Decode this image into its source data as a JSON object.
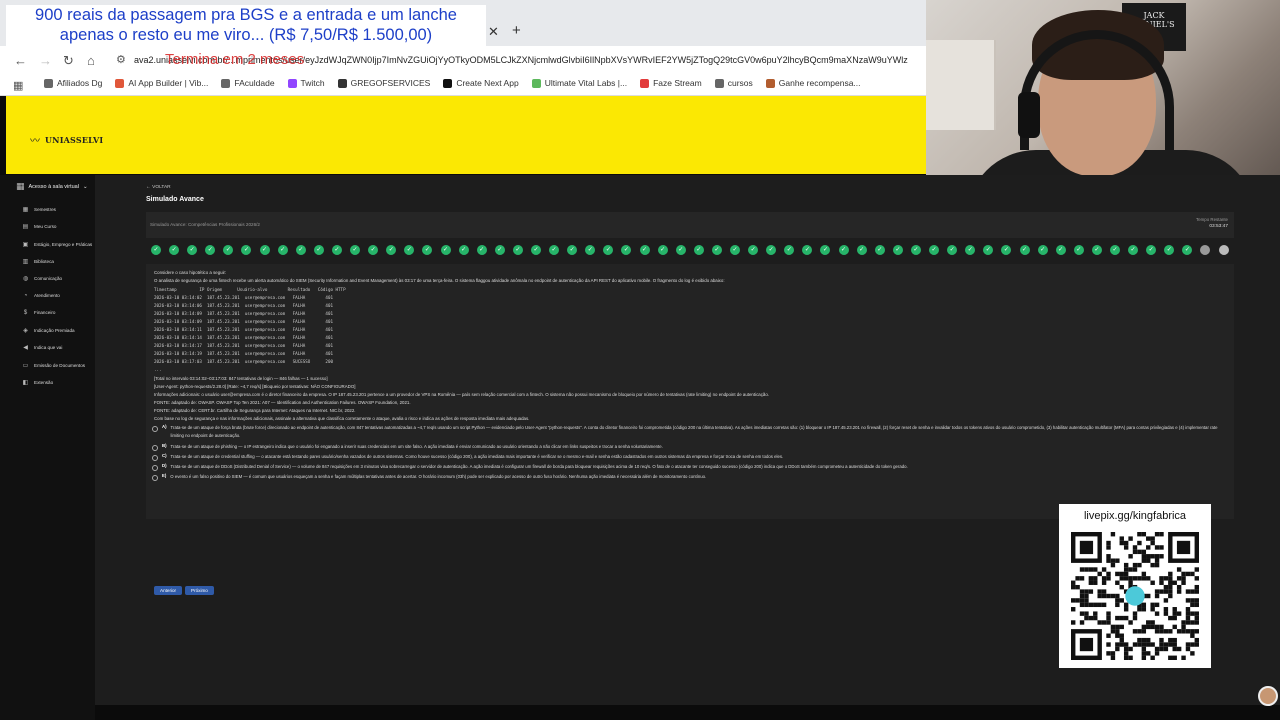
{
  "stream": {
    "banner": "900 reais da passagem pra BGS e a entrada e um lanche apenas o resto eu me viro... (R$ 7,50/R$ 1.500,00)",
    "countdown": "Termina em 2 meses",
    "qr_url": "livepix.gg/kingfabrica",
    "poster": "JACK DANIEL'S"
  },
  "browser": {
    "url": "ava2.uniasselvi.com.br/...mprimentos/user/eyJzdWJqZWN0Ijp7ImNvZGUiOjYyOTkyODM5LCJkZXNjcmlwdGlvbiI6IlNpbXVsYWRvIEF2YW5jZTogQ29tcGV0w6puY2lhcyBQcm9maXNzaW9uYWlz",
    "bookmarks": [
      {
        "label": "Afiliados Dg",
        "color": "#666666"
      },
      {
        "label": "AI App Builder | Vib...",
        "color": "#e0573a"
      },
      {
        "label": "FAculdade",
        "color": "#666666"
      },
      {
        "label": "Twitch",
        "color": "#9146ff"
      },
      {
        "label": "GREGOFSERVICES",
        "color": "#333333"
      },
      {
        "label": "Create Next App",
        "color": "#111111"
      },
      {
        "label": "Ultimate Vital Labs |...",
        "color": "#5cb85c"
      },
      {
        "label": "Faze Stream",
        "color": "#e23b3b"
      },
      {
        "label": "cursos",
        "color": "#666666"
      },
      {
        "label": "Ganhe recompensa...",
        "color": "#b25d2f"
      }
    ]
  },
  "brand": "UNIASSELVI",
  "sidebar": {
    "title": "Acesso à sala virtual",
    "items": [
      {
        "label": "Semestres",
        "icon": "calendar-icon",
        "glyph": "▦"
      },
      {
        "label": "Meu Curso",
        "icon": "book-icon",
        "glyph": "▤"
      },
      {
        "label": "Estágio, Emprego e Práticas",
        "icon": "briefcase-icon",
        "glyph": "▣"
      },
      {
        "label": "Biblioteca",
        "icon": "library-icon",
        "glyph": "▥"
      },
      {
        "label": "Comunicação",
        "icon": "chat-icon",
        "glyph": "◍"
      },
      {
        "label": "Atendimento",
        "icon": "headset-icon",
        "glyph": "◔"
      },
      {
        "label": "Financeiro",
        "icon": "dollar-icon",
        "glyph": "$"
      },
      {
        "label": "Indicação Premiada",
        "icon": "gift-icon",
        "glyph": "◈"
      },
      {
        "label": "Indica que vai",
        "icon": "megaphone-icon",
        "glyph": "◀"
      },
      {
        "label": "Emissão de Documentos",
        "icon": "document-icon",
        "glyph": "▭"
      },
      {
        "label": "Extensão",
        "icon": "puzzle-icon",
        "glyph": "◧"
      }
    ]
  },
  "main": {
    "back": "VOLTAR",
    "title": "Simulado Avance",
    "subtitle": "Simulado Avance: Competências Profissionais 2026/2",
    "timer_label": "Tempo Restante",
    "timer_value": "03:53:47",
    "progress": {
      "total": 60,
      "done": 58,
      "current": 59
    }
  },
  "question": {
    "intro": "Considere o caso hipotético a seguir:",
    "context": "O analista de segurança de uma fintech recebe um alerta automático do SIEM (Security Information and Event Management) às 03:17 de uma terça-feira. O sistema flaggou atividade anômala no endpoint de autenticação da API REST do aplicativo mobile. O fragmento do log é exibido abaixo:",
    "log_header": "Timestamp         IP Origem      Usuário-alvo        Resultado   Código HTTP",
    "log_rows": [
      "2026-03-10 03:14:02  187.45.23.201  user@empresa.com   FALHA        401",
      "2026-03-10 03:14:06  187.45.23.201  user@empresa.com   FALHA        401",
      "2026-03-10 03:14:09  187.45.23.201  user@empresa.com   FALHA        401",
      "2026-03-10 03:14:09  187.45.23.201  user@empresa.com   FALHA        401",
      "2026-03-10 03:14:11  187.45.23.201  user@empresa.com   FALHA        401",
      "2026-03-10 03:14:14  187.45.23.201  user@empresa.com   FALHA        401",
      "2026-03-10 03:14:17  187.45.23.201  user@empresa.com   FALHA        401",
      "2026-03-10 03:14:19  187.45.23.201  user@empresa.com   FALHA        401",
      "2026-03-10 03:17:03  187.45.23.201  user@empresa.com   SUCESSO      200"
    ],
    "log_dots": "...",
    "total_line": "[Total no intervalo 03:14:02–03:17:03: 847 tentativas de login — 846 falhas — 1 sucesso]",
    "agent_line": "[User-Agent: python-requests/2.28.0]  [Rate: ~4,7 req/s]  [Bloqueio por tentativas: NÃO CONFIGURADO]",
    "info_line": "Informações adicionais: o usuário user@empresa.com é o diretor financeiro da empresa. O IP 187.45.23.201 pertence a um provedor de VPS na Romênia — país sem relação comercial com a fintech. O sistema não possui mecanismo de bloqueio por número de tentativas (rate limiting) no endpoint de autenticação.",
    "source1": "FONTE: adaptado de: OWASP. OWASP Top Ten 2021: A07 — Identification and Authentication Failures. OWASP Foundation, 2021.",
    "source2": "FONTE: adaptado de: CERT.br. Cartilha de Segurança para Internet: Ataques na Internet. NIC.br, 2022.",
    "prompt": "Com base no log de segurança e nas informações adicionais, assinale a alternativa que classifica corretamente o ataque, avalia o risco e indica as ações de resposta imediata mais adequadas.",
    "options": [
      {
        "letter": "A)",
        "text": "Trata-se de um ataque de força bruta (brute force) direcionado ao endpoint de autenticação, com 847 tentativas automatizadas a ~4,7 req/s usando um script Python — evidenciado pelo User-Agent \"python-requests\". A conta do diretor financeiro foi comprometida (código 200 na última tentativa). As ações imediatas corretas são: (1) bloquear o IP 187.45.23.201 no firewall, (2) forçar reset de senha e invalidar todos os tokens ativos do usuário comprometido, (3) habilitar autenticação multifator (MFA) para contas privilegiadas e (4) implementar rate limiting no endpoint de autenticação."
      },
      {
        "letter": "B)",
        "text": "Trata-se de um ataque de phishing — o IP estrangeiro indica que o usuário foi enganado a inserir suas credenciais em um site falso. A ação imediata é enviar comunicado ao usuário orientando a não clicar em links suspeitos e trocar a senha voluntariamente."
      },
      {
        "letter": "C)",
        "text": "Trata-se de um ataque de credential stuffing — o atacante está testando pares usuário/senha vazados de outros sistemas. Como houve sucesso (código 200), a ação imediata mais importante é verificar se o mesmo e-mail e senha estão cadastrados em outros sistemas da empresa e forçar troca de senha em todos eles."
      },
      {
        "letter": "D)",
        "text": "Trata-se de um ataque de DDoS (Distributed Denial of Service) — o volume de 847 requisições em 3 minutos visa sobrecarregar o servidor de autenticação. A ação imediata é configurar um firewall de borda para bloquear requisições acima de 10 req/s. O fato de o atacante ter conseguido sucesso (código 200) indica que o DDoS também comprometeu a autenticidade do token gerado."
      },
      {
        "letter": "E)",
        "text": "O evento é um falso positivo do SIEM — é comum que usuários esqueçam a senha e façam múltiplas tentativas antes de acertar. O horário incomum (03h) pode ser explicado por acesso de outro fuso horário. Nenhuma ação imediata é necessária além de monitoramento contínuo."
      }
    ],
    "prev_button": "Anterior",
    "next_button": "Próximo"
  }
}
